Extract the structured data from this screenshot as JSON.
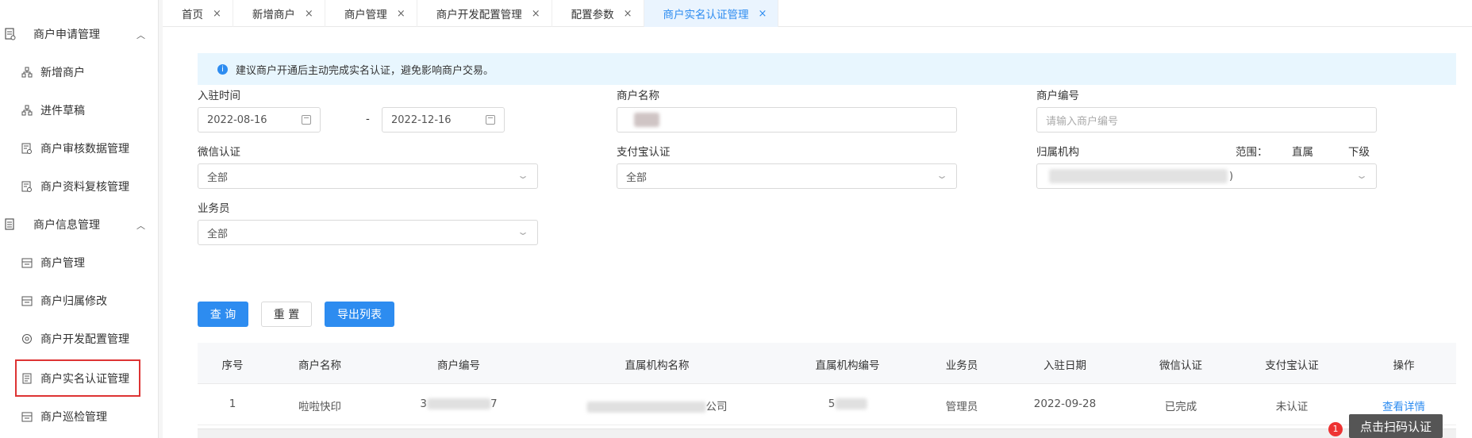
{
  "sidebar": {
    "groups": [
      {
        "label": "商户申请管理",
        "icon": "document-icon",
        "expanded": true
      },
      {
        "label": "商户信息管理",
        "icon": "list-document-icon",
        "expanded": true
      }
    ],
    "items": [
      {
        "label": "新增商户",
        "icon": "org-chart-icon"
      },
      {
        "label": "进件草稿",
        "icon": "org-chart-icon"
      },
      {
        "label": "商户审核数据管理",
        "icon": "audit-document-icon"
      },
      {
        "label": "商户资料复核管理",
        "icon": "audit-document-icon"
      },
      {
        "label": "商户管理",
        "icon": "store-icon"
      },
      {
        "label": "商户归属修改",
        "icon": "store-icon"
      },
      {
        "label": "商户开发配置管理",
        "icon": "settings-cycle-icon"
      },
      {
        "label": "商户实名认证管理",
        "icon": "id-card-icon"
      },
      {
        "label": "商户巡检管理",
        "icon": "store-icon"
      }
    ]
  },
  "tabs": [
    {
      "label": "首页",
      "active": false
    },
    {
      "label": "新增商户",
      "active": false
    },
    {
      "label": "商户管理",
      "active": false
    },
    {
      "label": "商户开发配置管理",
      "active": false
    },
    {
      "label": "配置参数",
      "active": false
    },
    {
      "label": "商户实名认证管理",
      "active": true
    }
  ],
  "tab_close": "×",
  "notice": {
    "icon": "info-icon",
    "glyph": "i",
    "text": "建议商户开通后主动完成实名认证，避免影响商户交易。"
  },
  "filters": {
    "entry_time": {
      "label": "入驻时间",
      "start": "2022-08-16",
      "separator": "-",
      "end": "2022-12-16"
    },
    "merchant_name": {
      "label": "商户名称"
    },
    "merchant_no": {
      "label": "商户编号",
      "placeholder": "请输入商户编号"
    },
    "wechat_auth": {
      "label": "微信认证",
      "value": "全部"
    },
    "alipay_auth": {
      "label": "支付宝认证",
      "value": "全部"
    },
    "org": {
      "label": "归属机构",
      "scope_label": "范围：",
      "direct": "直属",
      "subordinate": "下级",
      "suffix": ")"
    },
    "salesman": {
      "label": "业务员",
      "value": "全部"
    }
  },
  "buttons": {
    "query": "查 询",
    "reset": "重 置",
    "export": "导出列表"
  },
  "table": {
    "headers": [
      "序号",
      "商户名称",
      "商户编号",
      "直属机构名称",
      "直属机构编号",
      "业务员",
      "入驻日期",
      "微信认证",
      "支付宝认证",
      "操作"
    ],
    "rows": [
      {
        "index": "1",
        "name": "啦啦快印",
        "no_prefix": "3",
        "no_suffix": "7",
        "org_suffix": "公司",
        "org_no_prefix": "5",
        "salesman": "管理员",
        "date": "2022-09-28",
        "wechat": "已完成",
        "alipay": "未认证",
        "action": "查看详情"
      }
    ]
  },
  "tooltip": {
    "badge": "1",
    "text": "点击扫码认证"
  },
  "colors": {
    "primary": "#2d8cf0",
    "highlight_border": "#dd3333",
    "notice_bg": "#e8f6fe"
  }
}
